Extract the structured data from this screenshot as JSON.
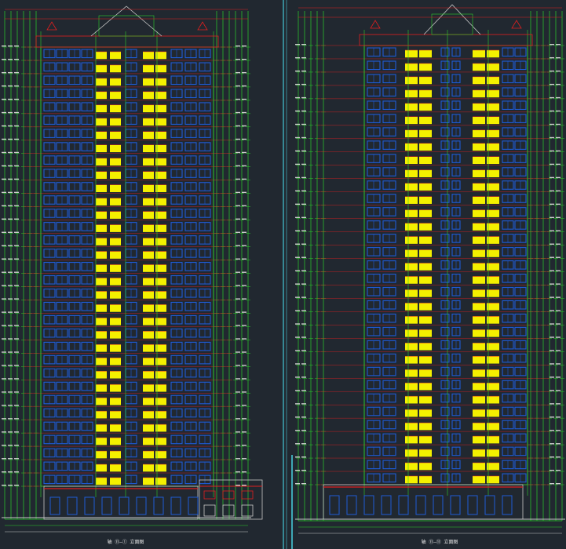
{
  "drawings": [
    {
      "id": "left",
      "title": "轴 ⑪—① 立面图",
      "colors": {
        "window": "#1f5bd6",
        "balcony": "#f4f000",
        "grid": "#2bd02b",
        "level": "#e02020",
        "frame": "#c8c8c8"
      }
    },
    {
      "id": "right",
      "title": "轴 ⑪—⑪ 立面图",
      "colors": {
        "window": "#1f5bd6",
        "balcony": "#f4f000",
        "grid": "#2bd02b",
        "level": "#e02020",
        "frame": "#c8c8c8"
      }
    }
  ],
  "background": "#212830",
  "divider": {
    "color": "#46c8d8"
  }
}
